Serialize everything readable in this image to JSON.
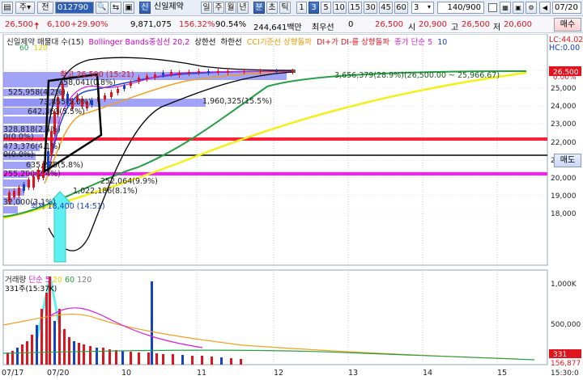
{
  "toolbar": {
    "market_label": "주",
    "market_arrow": "▾",
    "period_label": "전",
    "code": "012790",
    "search_icon_label": "🔍",
    "credit_label": "신",
    "name": "신일제약",
    "chart_modes": [
      "일",
      "주",
      "월",
      "년",
      "분",
      "초",
      "틱"
    ],
    "intervals": [
      "1",
      "3",
      "5",
      "10",
      "15",
      "30",
      "45",
      "60"
    ],
    "interval_input": "3",
    "count_display": "140/900",
    "nav_date": "07/20"
  },
  "quote": {
    "price": "26,500",
    "change": "6,100",
    "change_rate": "+29.90%",
    "volume": "9,871,075",
    "volume_rate": "156.32%",
    "turnover_rate": "90.54%",
    "amount": "244,641백만",
    "priority_label": "최우선",
    "priority_value": "0",
    "current": "26,500",
    "open_label": "시",
    "open": "20,900",
    "high_label": "고",
    "high": "26,500",
    "low_label": "저",
    "low": "20,600",
    "buy_label": "매수",
    "sell_label": "매도"
  },
  "price_panel": {
    "legend": [
      "신일제약 매물대 수(15)",
      "Bollinger Bands중심선 20,2",
      "상한선",
      "하한선",
      "CCI기준선 상향돌파",
      "DI+가 DI-를 상향돌파",
      "종가 단순 5",
      "10"
    ],
    "legend_line2": [
      "60",
      "120"
    ],
    "lc_label": "LC:44.02",
    "hc_label": "HC:0.00",
    "top_rate": "0.00%",
    "current_price_tag": "26,500",
    "high_marker": "최고 26,500 (15:21)",
    "low_marker": "최저 18,400 (14:51)",
    "profiles": [
      "358,041(0.8%)",
      "525,958(4.2%)",
      "73,855(5.0%)",
      "642,363(5.5%)",
      "328,818(2.6%)",
      "0(0.0%)",
      "473,376(4.1%)",
      "0(0.0%)",
      "635,275(5.8%)",
      "255,200(2.4%)",
      "252,064(9.9%)",
      "1,022,186(8.1%)",
      "32,000(3.1%)",
      "1,960,325(15.5%)",
      "3,656,379(28.9%)(26,500.00 ~ 25,966.67)"
    ],
    "y_ticks": [
      "26,000",
      "25,000",
      "24,000",
      "23,000",
      "22,000",
      "21,000",
      "20,000",
      "19,000",
      "18,000"
    ]
  },
  "volume_panel": {
    "legend": [
      "거래량",
      "단순",
      "5",
      "20",
      "60",
      "120"
    ],
    "volume_label": "331주(15:37K)",
    "y_ticks": [
      "1,000K",
      "500,000"
    ],
    "current_tag": "331",
    "bottom_tag": "156,877"
  },
  "x_axis": {
    "labels": [
      "07/17",
      "07/20",
      "10",
      "11",
      "12",
      "13",
      "14",
      "15"
    ],
    "time": "15:30:0"
  },
  "colors": {
    "up": "#e0141e",
    "down": "#1540c8",
    "bb": "#000000",
    "ma5": "#d61fd6",
    "ma10": "#1846d0",
    "ma20": "#f0a020",
    "ma60": "#22a044",
    "ma120": "#f5ef1a",
    "red_line": "#ff1f3a",
    "magenta_line": "#ff18ff",
    "profile_bar": "#8f93f5"
  }
}
